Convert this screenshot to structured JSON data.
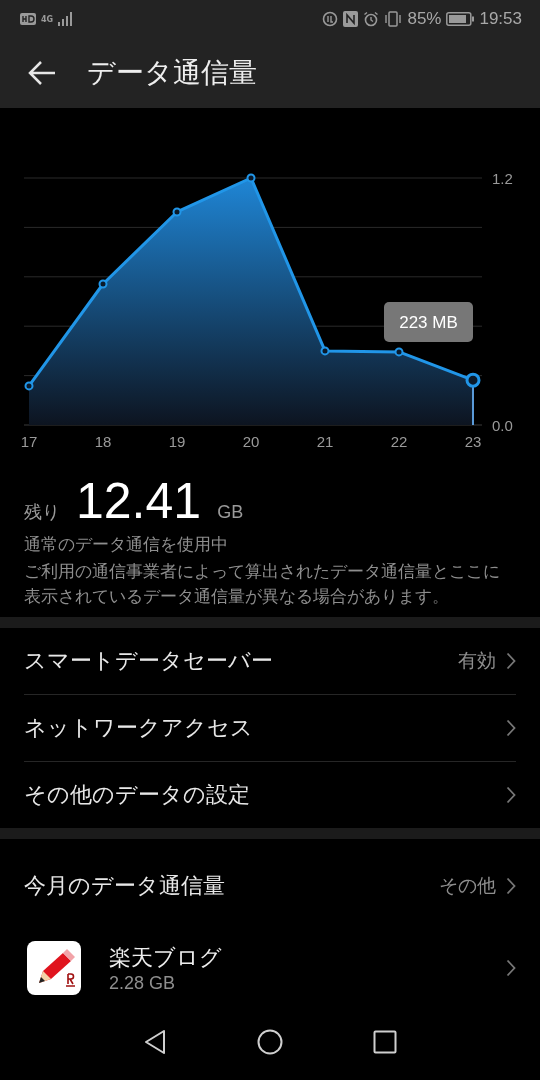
{
  "status_bar": {
    "network": "4G",
    "battery": "85%",
    "time": "19:53"
  },
  "header": {
    "title": "データ通信量"
  },
  "usage_chart": {
    "chart_data": {
      "type": "area",
      "categories": [
        "17",
        "18",
        "19",
        "20",
        "21",
        "22",
        "23"
      ],
      "series": [
        {
          "color": "#2196e8",
          "values": [
            0.19,
            0.685,
            1.035,
            1.2,
            0.36,
            0.355,
            0.218
          ]
        }
      ],
      "ylim": [
        0,
        1.2
      ],
      "yticks": [
        {
          "value": 0,
          "label": "0.0"
        },
        {
          "value": 1.2,
          "label": "1.2"
        }
      ],
      "annotations": [
        "223 MB"
      ]
    }
  },
  "remaining": {
    "label": "残り",
    "amount": "12.41",
    "unit": "GB"
  },
  "status_text": "通常のデータ通信を使用中",
  "note": "ご利用の通信事業者によって算出されたデータ通信量とここに表示されているデータ通信量が異なる場合があります。",
  "settings": [
    {
      "label": "スマートデータセーバー",
      "value": "有効"
    },
    {
      "label": "ネットワークアクセス"
    },
    {
      "label": "その他のデータの設定"
    }
  ],
  "monthly": {
    "title": "今月のデータ通信量",
    "action": "その他",
    "apps": [
      {
        "name": "楽天ブログ",
        "usage": "2.28 GB"
      }
    ]
  }
}
